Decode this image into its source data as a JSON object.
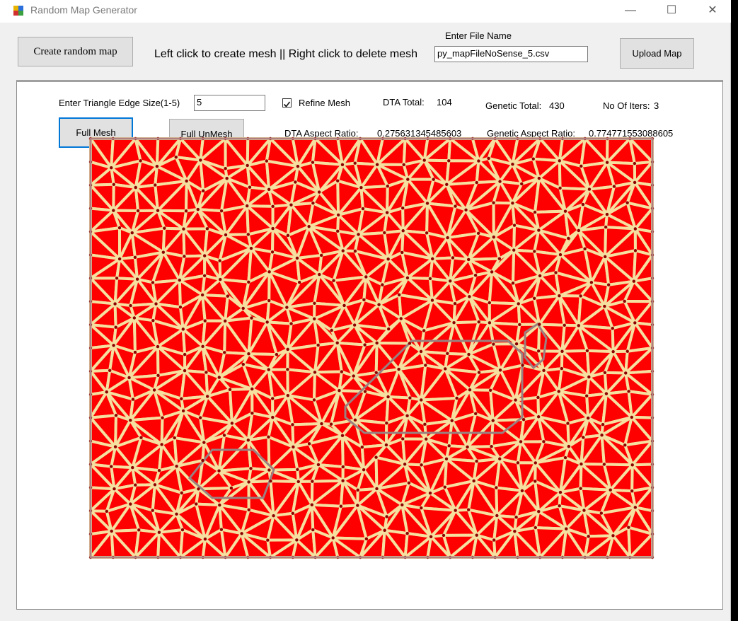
{
  "window": {
    "title": "Random Map Generator",
    "minimize": "—",
    "maximize": "☐",
    "close": "✕"
  },
  "toolbar": {
    "create_label": "Create random map",
    "instructions": "Left click to create mesh || Right click to delete mesh",
    "file_name_label": "Enter File Name",
    "file_name_value": "py_mapFileNoSense_5.csv",
    "upload_label": "Upload Map"
  },
  "controls": {
    "edge_size_label": "Enter Triangle Edge Size(1-5)",
    "edge_size_value": "5",
    "refine_label": "Refine Mesh",
    "refine_checked": true,
    "dta_total_label": "DTA Total:",
    "dta_total_value": "104",
    "genetic_total_label": "Genetic Total:",
    "genetic_total_value": "430",
    "iters_label": "No Of Iters:",
    "iters_value": "3",
    "full_mesh_label": "Full Mesh",
    "full_unmesh_label": "Full UnMesh",
    "dta_aspect_label": "DTA Aspect Ratio:",
    "dta_aspect_value": "0.275631345485603",
    "genetic_aspect_label": "Genetic Aspect Ratio:",
    "genetic_aspect_value": "0.774771553088605"
  },
  "colors": {
    "triangle_fill": "#ff0000",
    "mesh_edge": "#f5e0a0",
    "vertex": "#8b0000",
    "obstacle_outline": "#9a8080",
    "border": "#b08080"
  }
}
